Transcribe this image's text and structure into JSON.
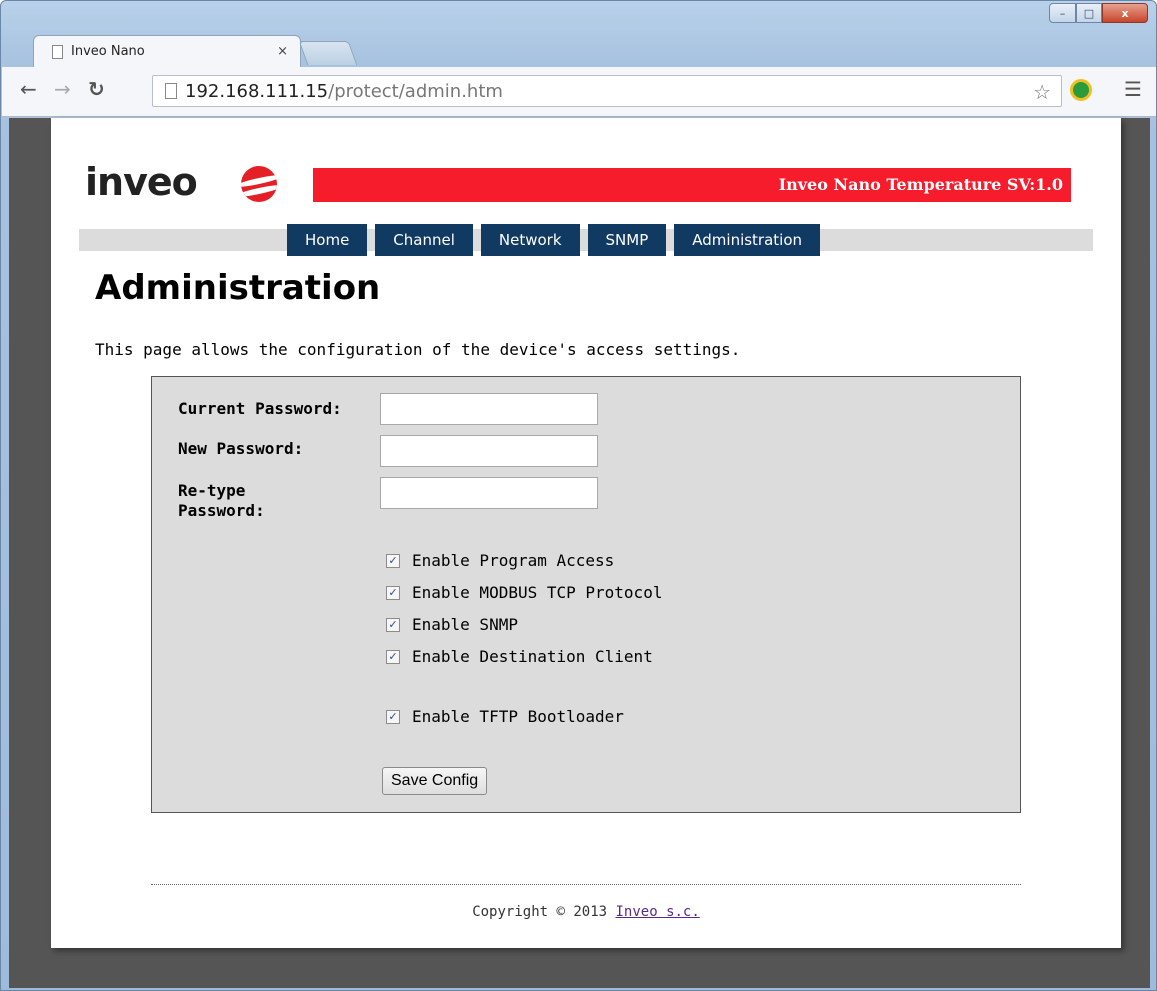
{
  "browser": {
    "tab_title": "Inveo Nano",
    "tab_close": "×",
    "url_host": "192.168.111.15",
    "url_path": "/protect/admin.htm",
    "window_controls": {
      "minimize": "–",
      "maximize": "□",
      "close": "x"
    }
  },
  "header": {
    "logo_text": "inveo",
    "banner": "Inveo Nano Temperature SV:1.0"
  },
  "nav": {
    "items": [
      {
        "label": "Home"
      },
      {
        "label": "Channel"
      },
      {
        "label": "Network"
      },
      {
        "label": "SNMP"
      },
      {
        "label": "Administration"
      }
    ]
  },
  "main": {
    "title": "Administration",
    "description": "This page allows the configuration of the device's access settings.",
    "fields": {
      "current_password": {
        "label": "Current Password:",
        "value": ""
      },
      "new_password": {
        "label": "New Password:",
        "value": ""
      },
      "retype_password": {
        "label_line1": "Re-type",
        "label_line2": "Password:",
        "value": ""
      }
    },
    "checkboxes": [
      {
        "label": "Enable Program Access",
        "checked": true
      },
      {
        "label": "Enable MODBUS TCP Protocol",
        "checked": true
      },
      {
        "label": "Enable SNMP",
        "checked": true
      },
      {
        "label": "Enable Destination Client",
        "checked": true
      },
      {
        "label": "Enable TFTP Bootloader",
        "checked": true
      }
    ],
    "save_label": "Save Config"
  },
  "footer": {
    "copyright": "Copyright © 2013 ",
    "link_text": "Inveo s.c."
  },
  "colors": {
    "banner_red": "#f71c2c",
    "nav_blue": "#113a62",
    "form_bg": "#dcdcdc"
  }
}
